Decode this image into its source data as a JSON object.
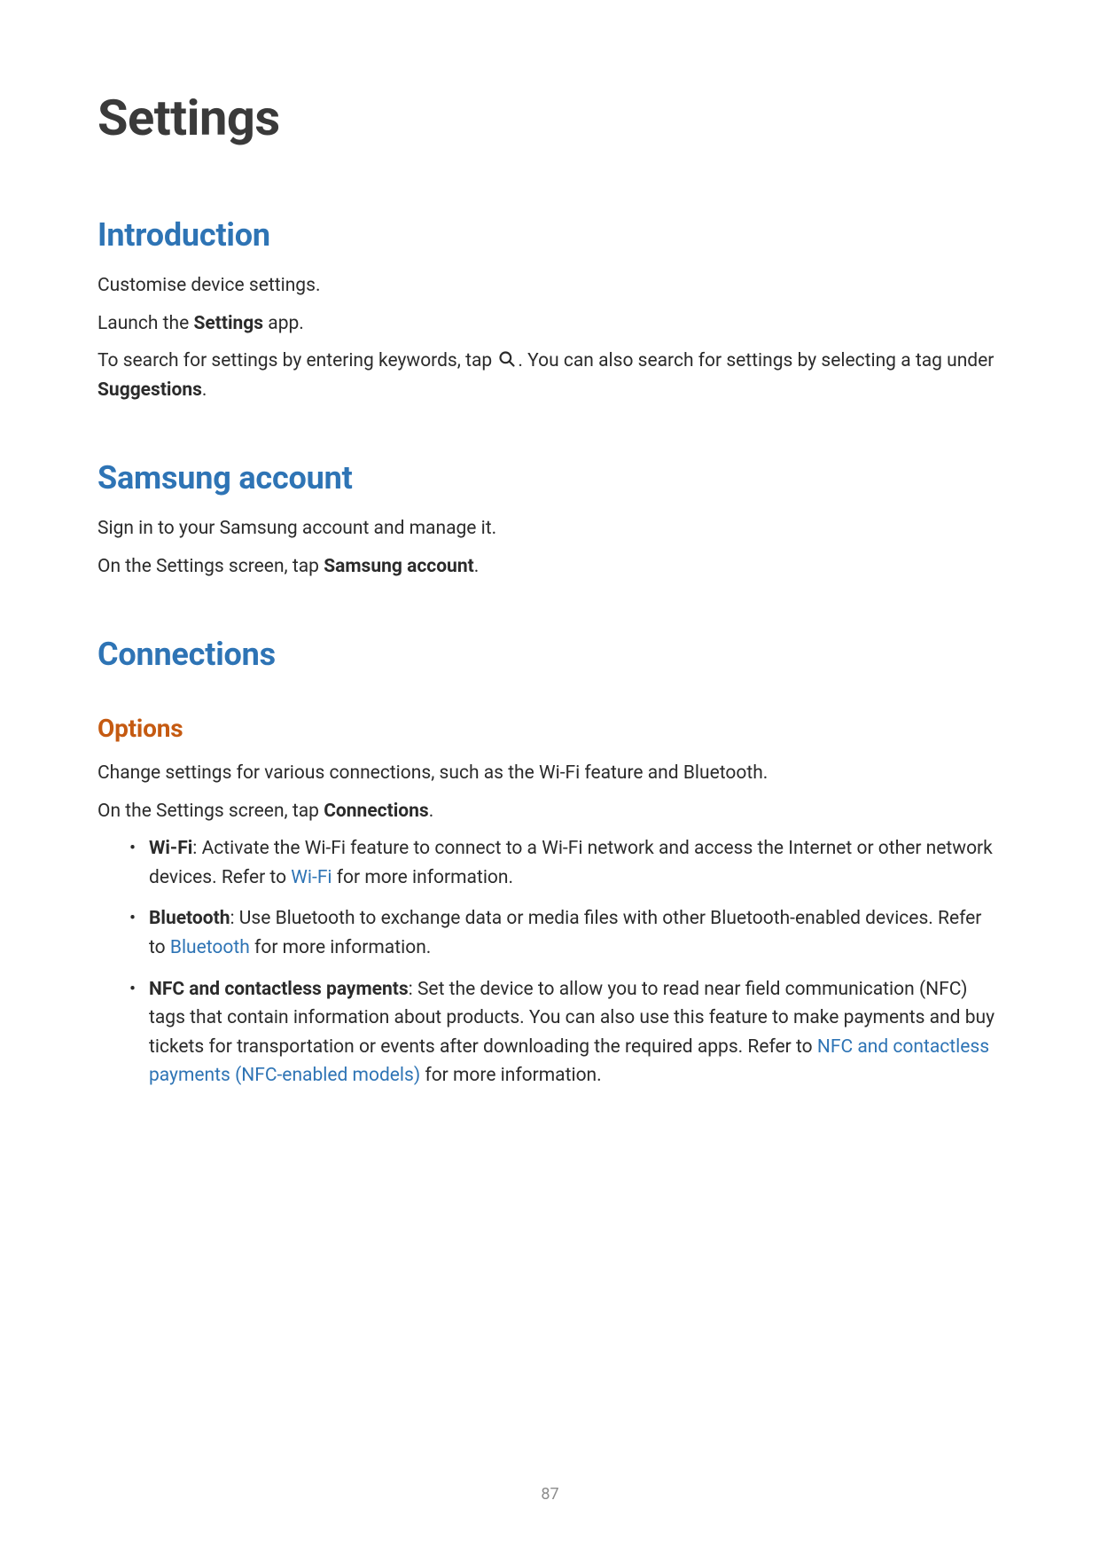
{
  "page_title": "Settings",
  "page_number": "87",
  "sections": {
    "introduction": {
      "heading": "Introduction",
      "para1": "Customise device settings.",
      "para2_prefix": "Launch the ",
      "para2_bold": "Settings",
      "para2_suffix": " app.",
      "para3_prefix": "To search for settings by entering keywords, tap ",
      "para3_suffix": ". You can also search for settings by selecting a tag under ",
      "para3_bold": "Suggestions",
      "para3_end": "."
    },
    "samsung_account": {
      "heading": "Samsung account",
      "para1": "Sign in to your Samsung account and manage it.",
      "para2_prefix": "On the Settings screen, tap ",
      "para2_bold": "Samsung account",
      "para2_end": "."
    },
    "connections": {
      "heading": "Connections",
      "options_heading": "Options",
      "para1": "Change settings for various connections, such as the Wi-Fi feature and Bluetooth.",
      "para2_prefix": "On the Settings screen, tap ",
      "para2_bold": "Connections",
      "para2_end": ".",
      "bullets": [
        {
          "bold": "Wi-Fi",
          "text_before_link": ": Activate the Wi-Fi feature to connect to a Wi-Fi network and access the Internet or other network devices. Refer to ",
          "link": "Wi-Fi",
          "text_after_link": " for more information."
        },
        {
          "bold": "Bluetooth",
          "text_before_link": ": Use Bluetooth to exchange data or media files with other Bluetooth-enabled devices. Refer to ",
          "link": "Bluetooth",
          "text_after_link": " for more information."
        },
        {
          "bold": "NFC and contactless payments",
          "text_before_link": ": Set the device to allow you to read near field communication (NFC) tags that contain information about products. You can also use this feature to make payments and buy tickets for transportation or events after downloading the required apps. Refer to ",
          "link": "NFC and contactless payments (NFC-enabled models)",
          "text_after_link": " for more information."
        }
      ]
    }
  }
}
